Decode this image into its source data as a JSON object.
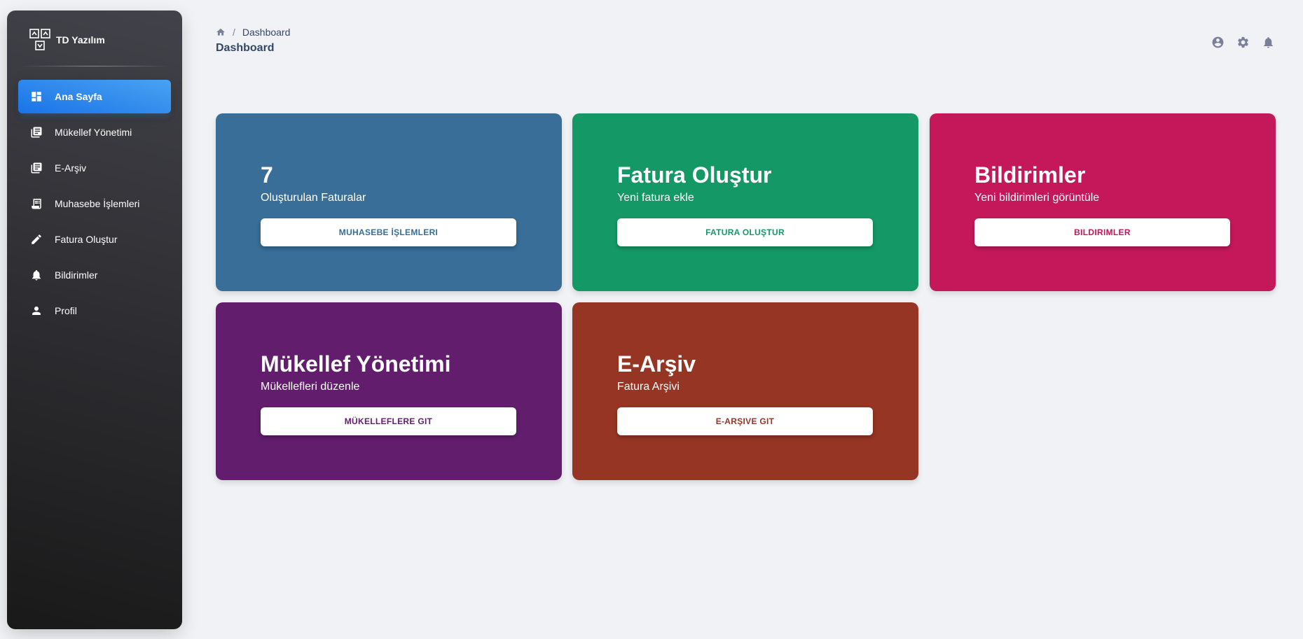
{
  "brand": {
    "name": "TD Yazılım"
  },
  "sidebar": {
    "items": [
      {
        "label": "Ana Sayfa",
        "icon": "dashboard-icon",
        "active": true
      },
      {
        "label": "Mükellef Yönetimi",
        "icon": "documents-icon"
      },
      {
        "label": "E-Arşiv",
        "icon": "documents-icon"
      },
      {
        "label": "Muhasebe İşlemleri",
        "icon": "receipt-icon"
      },
      {
        "label": "Fatura Oluştur",
        "icon": "pencil-icon"
      },
      {
        "label": "Bildirimler",
        "icon": "bell-icon"
      },
      {
        "label": "Profil",
        "icon": "person-icon"
      }
    ]
  },
  "header": {
    "breadcrumb_current": "Dashboard",
    "title": "Dashboard",
    "icons": [
      "account-circle-icon",
      "settings-icon",
      "notifications-icon"
    ]
  },
  "cards": [
    {
      "title": "7",
      "subtitle": "Oluşturulan Faturalar",
      "button": "MUHASEBE İŞLEMLERI",
      "color": "#386e98"
    },
    {
      "title": "Fatura Oluştur",
      "subtitle": "Yeni fatura ekle",
      "button": "FATURA OLUŞTUR",
      "color": "#149966"
    },
    {
      "title": "Bildirimler",
      "subtitle": "Yeni bildirimleri görüntüle",
      "button": "BILDIRIMLER",
      "color": "#c4185a"
    },
    {
      "title": "Mükellef Yönetimi",
      "subtitle": "Mükellefleri düzenle",
      "button": "MÜKELLEFLERE GIT",
      "color": "#621d6d"
    },
    {
      "title": "E-Arşiv",
      "subtitle": "Fatura Arşivi",
      "button": "E-ARŞIVE GIT",
      "color": "#963524"
    }
  ],
  "colors": {
    "accent": "#1A73E8",
    "text": "#344767",
    "muted": "#7b809a",
    "background": "#f0f2f5"
  }
}
